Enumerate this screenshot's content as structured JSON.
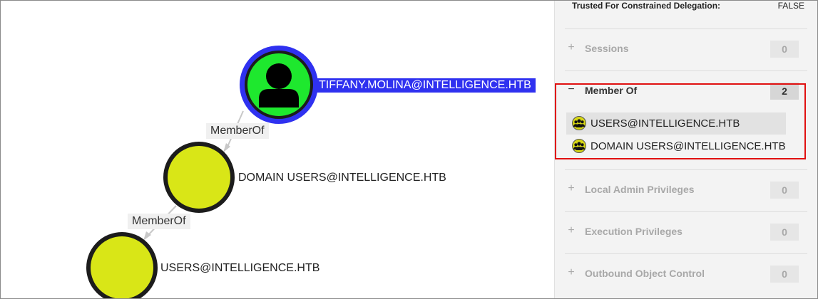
{
  "graph": {
    "nodes": [
      {
        "id": "tiffany",
        "label": "TIFFANY.MOLINA@INTELLIGENCE.HTB",
        "type": "user",
        "selected": true
      },
      {
        "id": "domain_users",
        "label": "DOMAIN USERS@INTELLIGENCE.HTB",
        "type": "group"
      },
      {
        "id": "users",
        "label": "USERS@INTELLIGENCE.HTB",
        "type": "group"
      }
    ],
    "edges": [
      {
        "from": "tiffany",
        "to": "domain_users",
        "label": "MemberOf"
      },
      {
        "from": "domain_users",
        "to": "users",
        "label": "MemberOf"
      }
    ],
    "colors": {
      "user": "#1ee82e",
      "user_ring": "#2f31f0",
      "group": "#d9e617",
      "node_border": "#1c1c1c",
      "edge": "#c8c8c8"
    }
  },
  "panel": {
    "property": {
      "key": "Trusted For Constrained Delegation:",
      "value": "FALSE"
    },
    "sections": [
      {
        "title": "Sessions",
        "count": "0",
        "toggle": "+"
      },
      {
        "title": "Member Of",
        "count": "2",
        "toggle": "−",
        "expanded": true,
        "items": [
          "USERS@INTELLIGENCE.HTB",
          "DOMAIN USERS@INTELLIGENCE.HTB"
        ]
      },
      {
        "title": "Local Admin Privileges",
        "count": "0",
        "toggle": "+"
      },
      {
        "title": "Execution Privileges",
        "count": "0",
        "toggle": "+"
      },
      {
        "title": "Outbound Object Control",
        "count": "0",
        "toggle": "+"
      }
    ],
    "item_icon": "group-icon"
  }
}
